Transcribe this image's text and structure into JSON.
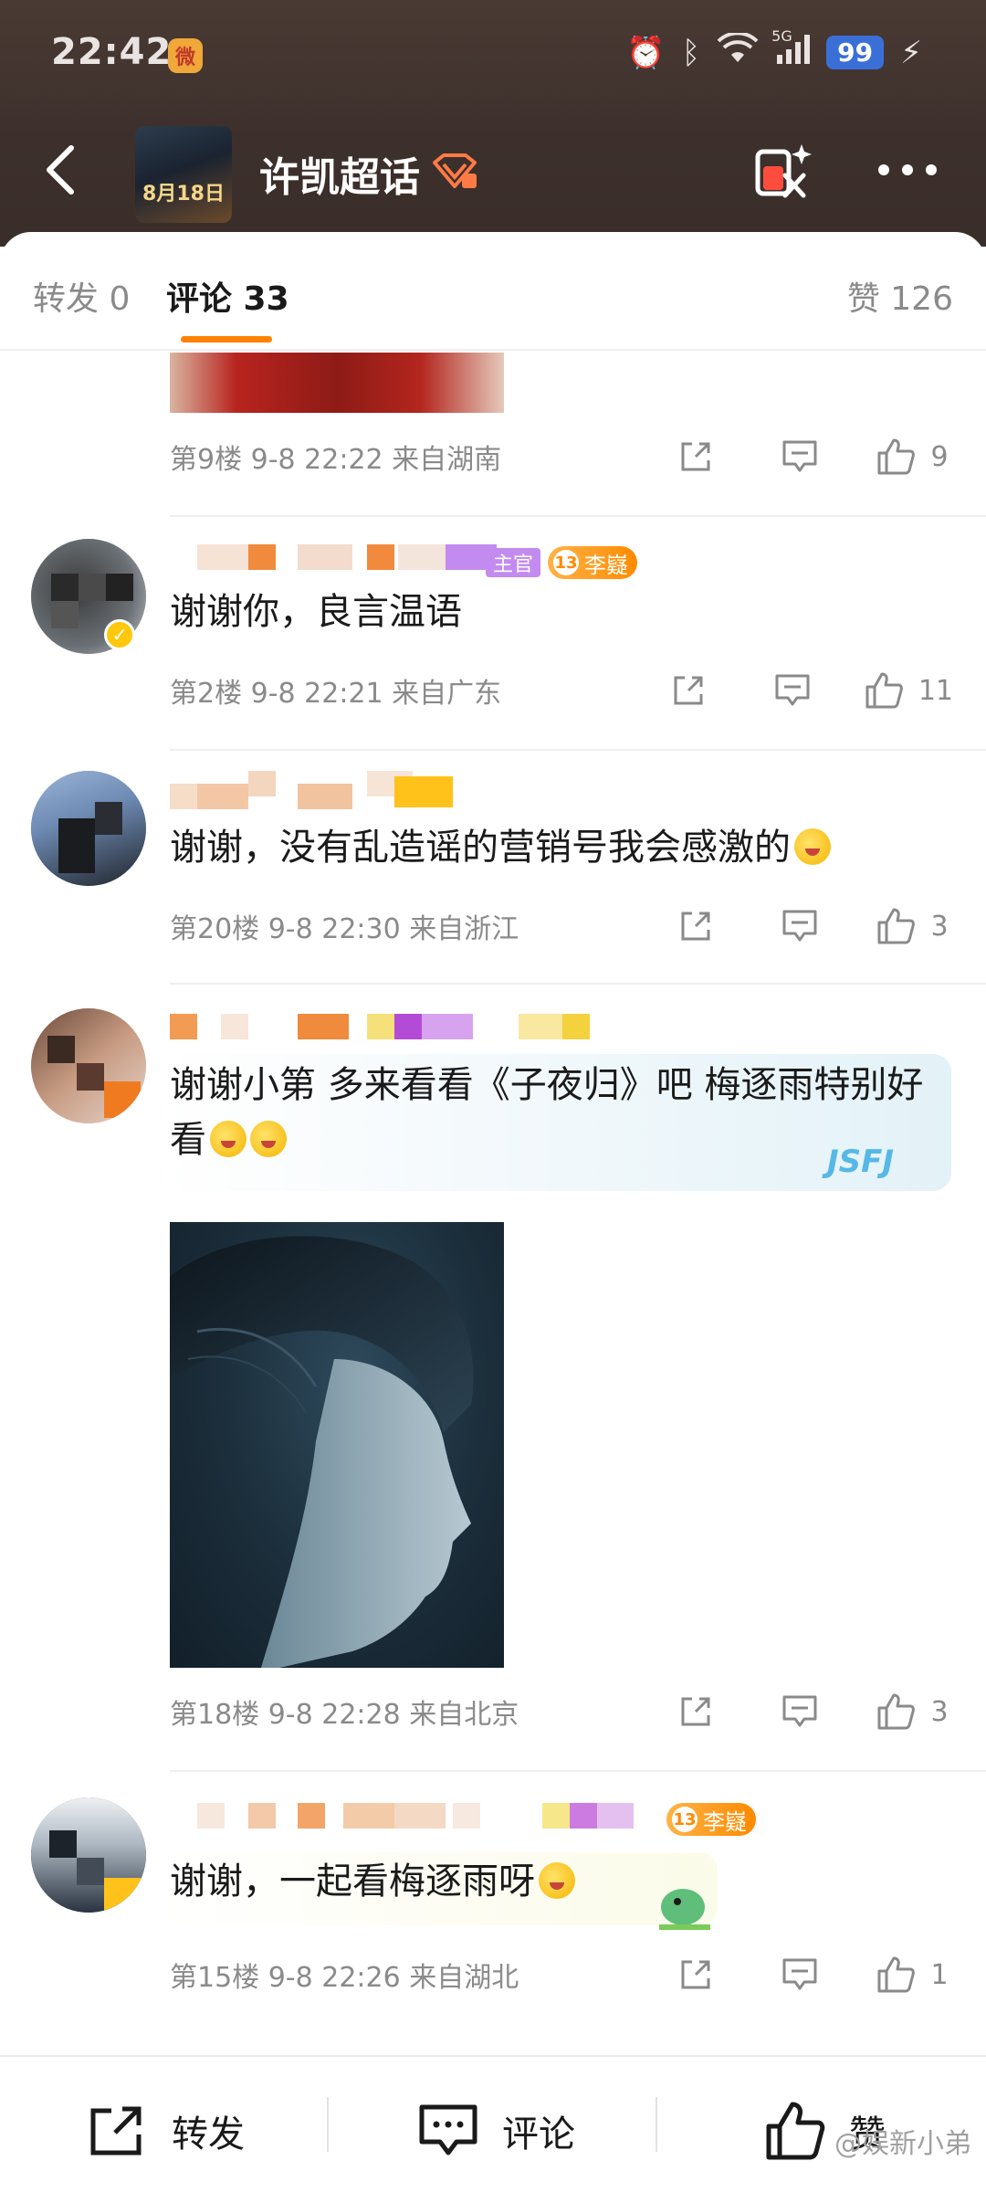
{
  "status_bar": {
    "time": "22:42",
    "battery": "99",
    "signal": "5G"
  },
  "nav": {
    "title": "许凯超话",
    "poster_text": "8月18日"
  },
  "tabs": {
    "repost": "转发 0",
    "comments": "评论 33",
    "likes": "赞 126"
  },
  "comments": [
    {
      "floor_meta": "第9楼  9-8 22:22  来自湖南",
      "likes": "9"
    },
    {
      "badge_official": "主官",
      "badge_level": "13",
      "badge_name": "李嶷",
      "text": "谢谢你，良言温语",
      "floor_meta": "第2楼  9-8 22:21  来自广东",
      "likes": "11"
    },
    {
      "text": "谢谢，没有乱造谣的营销号我会感激的",
      "floor_meta": "第20楼  9-8 22:30  来自浙江",
      "likes": "3"
    },
    {
      "text": "谢谢小第 多来看看《子夜归》吧 梅逐雨特别好看",
      "floor_meta": "第18楼  9-8 22:28  来自北京",
      "likes": "3",
      "bubble_tag": "JSFJ"
    },
    {
      "badge_level": "13",
      "badge_name": "李嶷",
      "text": "谢谢，一起看梅逐雨呀",
      "floor_meta": "第15楼  9-8 22:26  来自湖北",
      "likes": "1"
    }
  ],
  "bottom_bar": {
    "repost": "转发",
    "comment": "评论",
    "like": "赞"
  },
  "watermark": "@娱新小弟",
  "colors": {
    "accent": "#ff8200",
    "header_bg": "#3d302c",
    "meta_gray": "#8a8a8a"
  }
}
